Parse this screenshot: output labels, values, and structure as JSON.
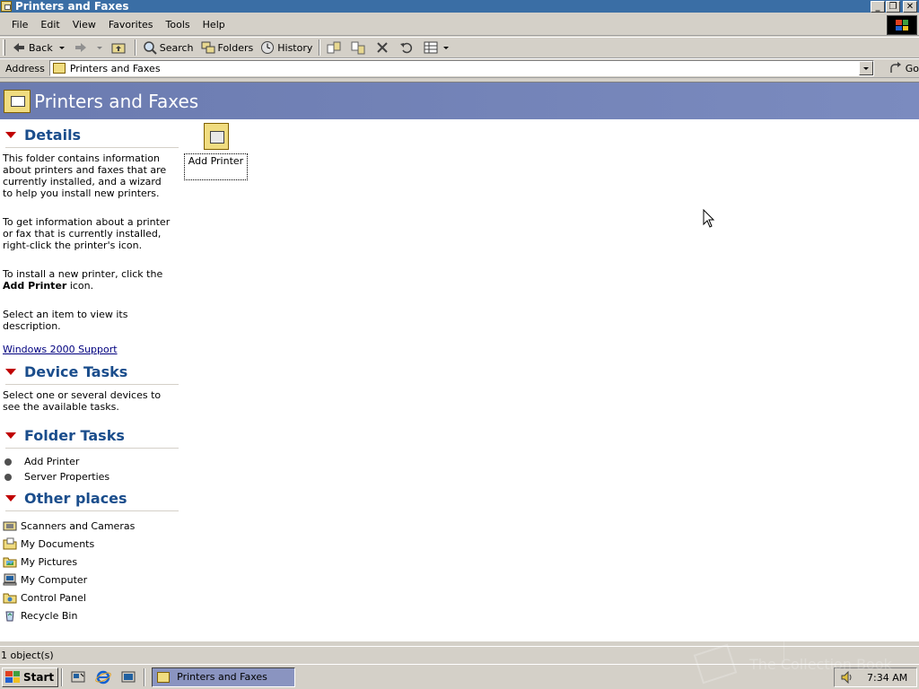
{
  "window": {
    "title": "Printers and Faxes",
    "controls": {
      "minimize": "_",
      "restore": "❐",
      "close": "✕"
    }
  },
  "menu": [
    "File",
    "Edit",
    "View",
    "Favorites",
    "Tools",
    "Help"
  ],
  "toolbar": {
    "back_label": "Back",
    "search_label": "Search",
    "folders_label": "Folders",
    "history_label": "History"
  },
  "address": {
    "label": "Address",
    "value": "Printers and Faxes",
    "go_label": "Go"
  },
  "banner": {
    "title": "Printers and Faxes"
  },
  "details": {
    "heading": "Details",
    "p1": "This folder contains information about printers and faxes that are currently installed, and a wizard to help you install new printers.",
    "p2": "To get information about a printer or fax that is currently installed, right-click the printer's icon.",
    "p3_prefix": "To install a new printer, click the ",
    "p3_bold": "Add Printer",
    "p3_suffix": " icon.",
    "p4": "Select an item to view its description.",
    "link": "Windows 2000 Support"
  },
  "device_tasks": {
    "heading": "Device Tasks",
    "text": "Select one or several devices to see the available tasks."
  },
  "folder_tasks": {
    "heading": "Folder Tasks",
    "items": [
      "Add Printer",
      "Server Properties"
    ]
  },
  "other_places": {
    "heading": "Other places",
    "items": [
      "Scanners and Cameras",
      "My Documents",
      "My Pictures",
      "My Computer",
      "Control Panel",
      "Recycle Bin"
    ]
  },
  "icons": [
    {
      "label": "Add Printer",
      "icon": "add-printer-icon"
    }
  ],
  "status": {
    "text": "1 object(s)"
  },
  "taskbar": {
    "start_label": "Start",
    "active_window": "Printers and Faxes",
    "clock": "7:34 AM"
  },
  "watermark": {
    "text": "The Collection Book"
  },
  "colors": {
    "titlebar": "#3a6ea5",
    "banner": "#7080b8",
    "section_heading": "#1a4d8c",
    "triangle": "#c00000",
    "link": "#00007f"
  }
}
